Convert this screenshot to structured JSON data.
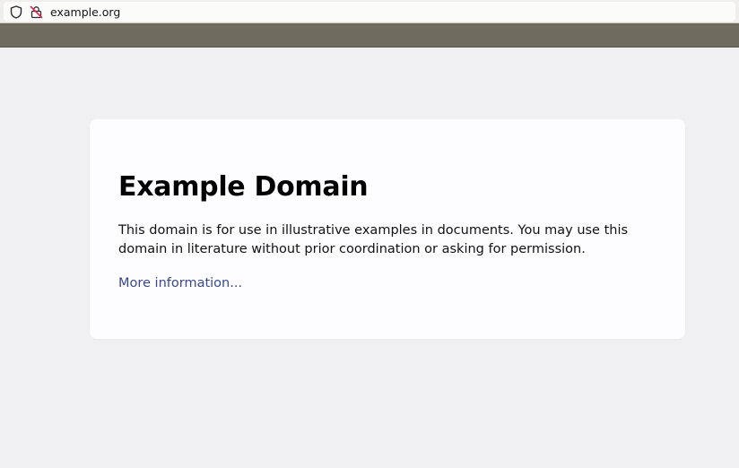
{
  "browser": {
    "url": "example.org",
    "icons": [
      "shield-icon",
      "insecure-lock-icon"
    ]
  },
  "colors": {
    "page_bg": "#f0f0f2",
    "card_bg": "#fdfdff",
    "link": "#38488f",
    "toolbar": "#6e6b5f"
  },
  "page": {
    "title": "Example Domain",
    "description": "This domain is for use in illustrative examples in documents. You may use this domain in literature without prior coordination or asking for permission.",
    "link_text": "More information..."
  }
}
